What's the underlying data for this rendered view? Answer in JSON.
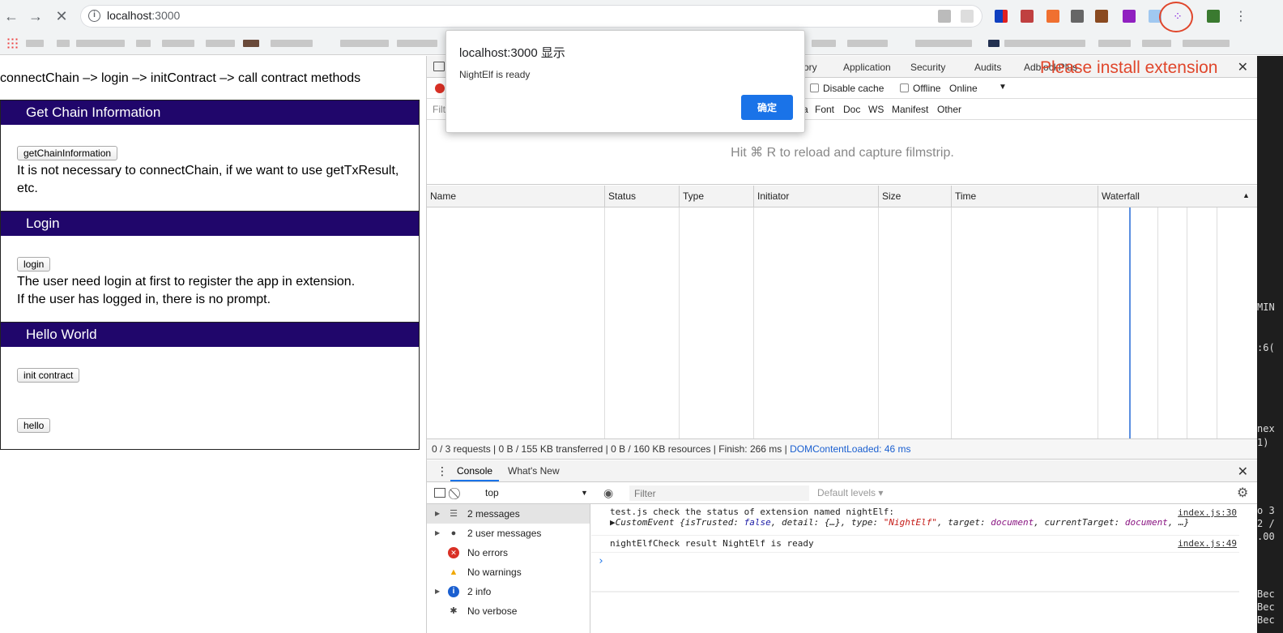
{
  "browser": {
    "url_host": "localhost",
    "url_port": ":3000",
    "back_label": "←",
    "forward_label": "→",
    "stop_label": "✕",
    "menu_label": "⋮"
  },
  "page": {
    "intro": "connectChain –> login –> initContract –> call contract methods",
    "sections": [
      {
        "title": "Get Chain Information",
        "buttons": [
          "getChainInformation"
        ],
        "text": "It is not necessary to connectChain, if we want to use getTxResult, etc."
      },
      {
        "title": "Login",
        "buttons": [
          "login"
        ],
        "text1": "The user need login at first to register the app in extension.",
        "text2": "If the user has logged in, there is no prompt."
      },
      {
        "title": "Hello World",
        "buttons": [
          "init contract",
          "hello"
        ]
      }
    ]
  },
  "alert": {
    "title": "localhost:3000 显示",
    "message": "NightElf is ready",
    "ok_label": "确定"
  },
  "overlay": {
    "please_install": "Please install extension"
  },
  "devtools": {
    "tabs": [
      "mory",
      "Application",
      "Security",
      "Audits",
      "AdblockPlus"
    ],
    "net_options": {
      "disable_cache": "Disable cache",
      "offline": "Offline",
      "throttle": "Online"
    },
    "filter_types": [
      "a",
      "Font",
      "Doc",
      "WS",
      "Manifest",
      "Other"
    ],
    "filter_prefix": "Filt",
    "filmstrip_hint": "Hit ⌘ R to reload and capture filmstrip.",
    "columns": [
      "Name",
      "Status",
      "Type",
      "Initiator",
      "Size",
      "Time",
      "Waterfall"
    ],
    "status": {
      "requests": "0 / 3 requests",
      "transferred": "0 B / 155 KB transferred",
      "resources": "0 B / 160 KB resources",
      "finish": "Finish: 266 ms",
      "dcl": "DOMContentLoaded: 46 ms"
    },
    "drawer_tabs": [
      "Console",
      "What's New"
    ],
    "console_context": "top",
    "console_filter_placeholder": "Filter",
    "default_levels": "Default levels ▾",
    "sidebar": [
      {
        "label": "2 messages",
        "icon": "list-icon",
        "glyph": "☰",
        "color": "#555",
        "arrow": true,
        "selected": true
      },
      {
        "label": "2 user messages",
        "icon": "user-icon",
        "glyph": "●",
        "color": "#444",
        "arrow": true
      },
      {
        "label": "No errors",
        "icon": "error-icon",
        "glyph": "✕",
        "color": "#d93025"
      },
      {
        "label": "No warnings",
        "icon": "warning-icon",
        "glyph": "▲",
        "color": "#f0a800"
      },
      {
        "label": "2 info",
        "icon": "info-icon",
        "glyph": "i",
        "color": "#1a5fd0",
        "arrow": true
      },
      {
        "label": "No verbose",
        "icon": "bug-icon",
        "glyph": "✱",
        "color": "#444"
      }
    ],
    "logs": [
      {
        "text": "test.js check the status of extension named nightElf:",
        "src": "index.js:30"
      },
      {
        "object_prefix": "▶CustomEvent {isTrusted: ",
        "isTrusted": "false",
        "mid1": ", detail: {…}, type: ",
        "type": "\"NightElf\"",
        "mid2": ", target: ",
        "target": "document",
        "mid3": ", currentTarget: ",
        "current": "document",
        "tail": ", …}"
      },
      {
        "text": "nightElfCheck result NightElf is ready",
        "src": "index.js:49"
      }
    ],
    "prompt": "›"
  },
  "right_edge": [
    "MIN",
    ":6(",
    "nex",
    "1)",
    "o 3",
    "2 /",
    ".00",
    "Bec",
    "Bec",
    "Bec"
  ]
}
